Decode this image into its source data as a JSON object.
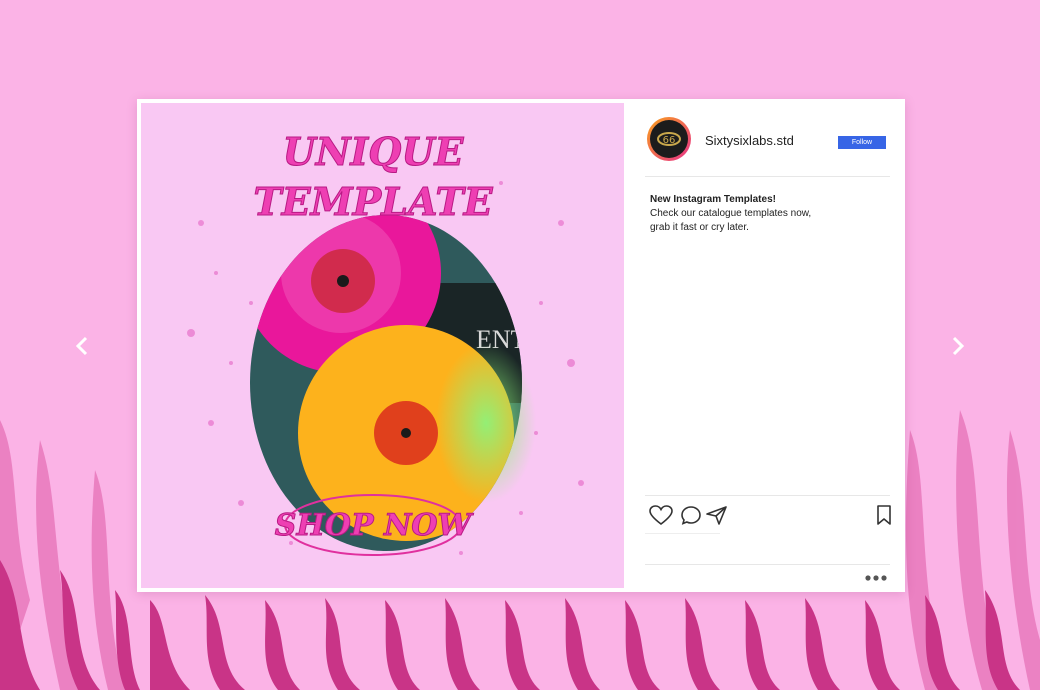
{
  "colors": {
    "page_background": "#fbb3e6",
    "zebra_stripe": "#d8479a",
    "follow_button": "#3765e6",
    "card_background": "#ffffff"
  },
  "navigation": {
    "prev_icon": "chevron-left-icon",
    "next_icon": "chevron-right-icon"
  },
  "post": {
    "image": {
      "headline_line1": "UNIQUE",
      "headline_line2": "TEMPLATE",
      "cta": "SHOP NOW"
    },
    "header": {
      "avatar_icon": "brand-logo-icon",
      "username": "Sixtysixlabs.std",
      "follow_label": "Follow"
    },
    "caption": {
      "title": "New Instagram Templates!",
      "line1": "Check our catalogue templates now,",
      "line2": "grab it fast or cry later."
    },
    "actions": {
      "like_icon": "heart-icon",
      "comment_icon": "comment-icon",
      "share_icon": "send-icon",
      "save_icon": "bookmark-icon",
      "more_icon": "more-dots-icon"
    }
  }
}
